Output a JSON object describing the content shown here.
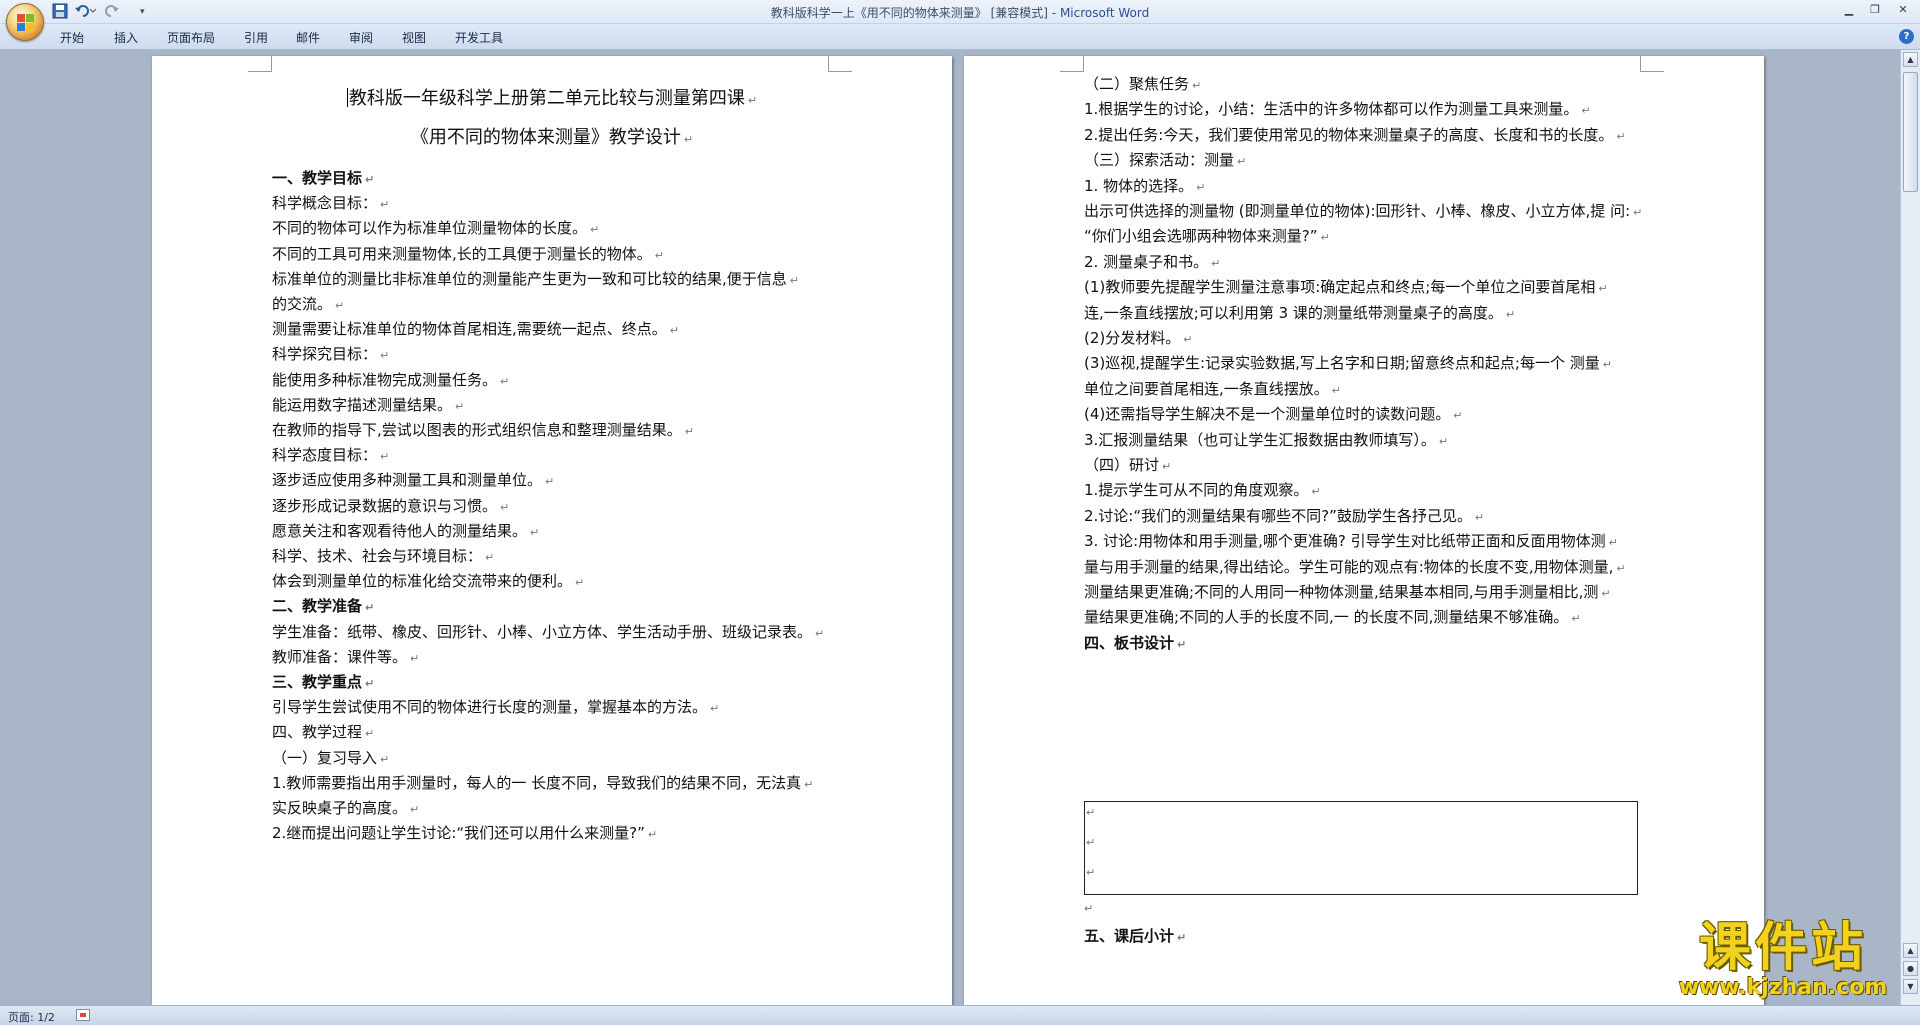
{
  "window": {
    "title": "教科版科学一上《用不同的物体来测量》 [兼容模式]",
    "app_name": "Microsoft Word",
    "quick_access": [
      "save-icon",
      "undo-icon",
      "redo-icon",
      "customize-icon"
    ]
  },
  "ribbon": {
    "tabs": [
      "开始",
      "插入",
      "页面布局",
      "引用",
      "邮件",
      "审阅",
      "视图",
      "开发工具"
    ]
  },
  "status": {
    "page": "页面: 1/2"
  },
  "watermark": {
    "name": "课件站",
    "url": "www.kjzhan.com"
  },
  "page1": {
    "title": "教科版一年级科学上册第二单元比较与测量第四课",
    "subtitle": "《用不同的物体来测量》教学设计",
    "lines": [
      {
        "text": "一、教学目标",
        "bold": true
      },
      {
        "text": "科学概念目标："
      },
      {
        "text": "不同的物体可以作为标准单位测量物体的长度。"
      },
      {
        "text": "不同的工具可用来测量物体,长的工具便于测量长的物体。"
      },
      {
        "text": "标准单位的测量比非标准单位的测量能产生更为一致和可比较的结果,便于信息"
      },
      {
        "text": "的交流。"
      },
      {
        "text": "测量需要让标准单位的物体首尾相连,需要统一起点、终点。"
      },
      {
        "text": "科学探究目标："
      },
      {
        "text": "能使用多种标准物完成测量任务。"
      },
      {
        "text": "能运用数字描述测量结果。"
      },
      {
        "text": "在教师的指导下,尝试以图表的形式组织信息和整理测量结果。"
      },
      {
        "text": "科学态度目标："
      },
      {
        "text": "逐步适应使用多种测量工具和测量单位。"
      },
      {
        "text": "逐步形成记录数据的意识与习惯。"
      },
      {
        "text": "愿意关注和客观看待他人的测量结果。"
      },
      {
        "text": "科学、技术、社会与环境目标："
      },
      {
        "text": "体会到测量单位的标准化给交流带来的便利。"
      },
      {
        "text": "二、教学准备",
        "bold": true
      },
      {
        "text": "学生准备：纸带、橡皮、回形针、小棒、小立方体、学生活动手册、班级记录表。"
      },
      {
        "text": "教师准备：课件等。"
      },
      {
        "text": "三、教学重点",
        "bold": true
      },
      {
        "text": "引导学生尝试使用不同的物体进行长度的测量，掌握基本的方法。"
      },
      {
        "text": "四、教学过程"
      },
      {
        "text": "（一）复习导入"
      },
      {
        "text": "1.教师需要指出用手测量时，每人的一 长度不同，导致我们的结果不同，无法真"
      },
      {
        "text": "实反映桌子的高度。"
      },
      {
        "text": "2.继而提出问题让学生讨论:“我们还可以用什么来测量?”"
      }
    ]
  },
  "page2": {
    "lines": [
      {
        "text": "（二）聚焦任务"
      },
      {
        "text": "1.根据学生的讨论，小结：生活中的许多物体都可以作为测量工具来测量。"
      },
      {
        "text": "2.提出任务:今天，我们要使用常见的物体来测量桌子的高度、长度和书的长度。"
      },
      {
        "text": "（三）探索活动：测量"
      },
      {
        "text": "1. 物体的选择。"
      },
      {
        "text": "出示可供选择的测量物 (即测量单位的物体):回形针、小棒、橡皮、小立方体,提 问:"
      },
      {
        "text": "“你们小组会选哪两种物体来测量?”"
      },
      {
        "text": "2. 测量桌子和书。"
      },
      {
        "text": "(1)教师要先提醒学生测量注意事项:确定起点和终点;每一个单位之间要首尾相"
      },
      {
        "text": "连,一条直线摆放;可以利用第 3 课的测量纸带测量桌子的高度。"
      },
      {
        "text": "(2)分发材料。"
      },
      {
        "text": "(3)巡视,提醒学生:记录实验数据,写上名字和日期;留意终点和起点;每一个 测量"
      },
      {
        "text": "单位之间要首尾相连,一条直线摆放。"
      },
      {
        "text": "(4)还需指导学生解决不是一个测量单位时的读数问题。"
      },
      {
        "text": "3.汇报测量结果（也可让学生汇报数据由教师填写）。"
      },
      {
        "text": "（四）研讨"
      },
      {
        "text": "1.提示学生可从不同的角度观察。"
      },
      {
        "text": "2.讨论:“我们的测量结果有哪些不同?”鼓励学生各抒己见。"
      },
      {
        "text": "3. 讨论:用物体和用手测量,哪个更准确? 引导学生对比纸带正面和反面用物体测"
      },
      {
        "text": "量与用手测量的结果,得出结论。学生可能的观点有:物体的长度不变,用物体测量,"
      },
      {
        "text": "测量结果更准确;不同的人用同一种物体测量,结果基本相同,与用手测量相比,测"
      },
      {
        "text": "量结果更准确;不同的人手的长度不同,一 的长度不同,测量结果不够准确。"
      },
      {
        "text": "四、板书设计",
        "bold": true
      }
    ],
    "last_heading": "五、课后小计",
    "paragraph_mark": "↵"
  }
}
